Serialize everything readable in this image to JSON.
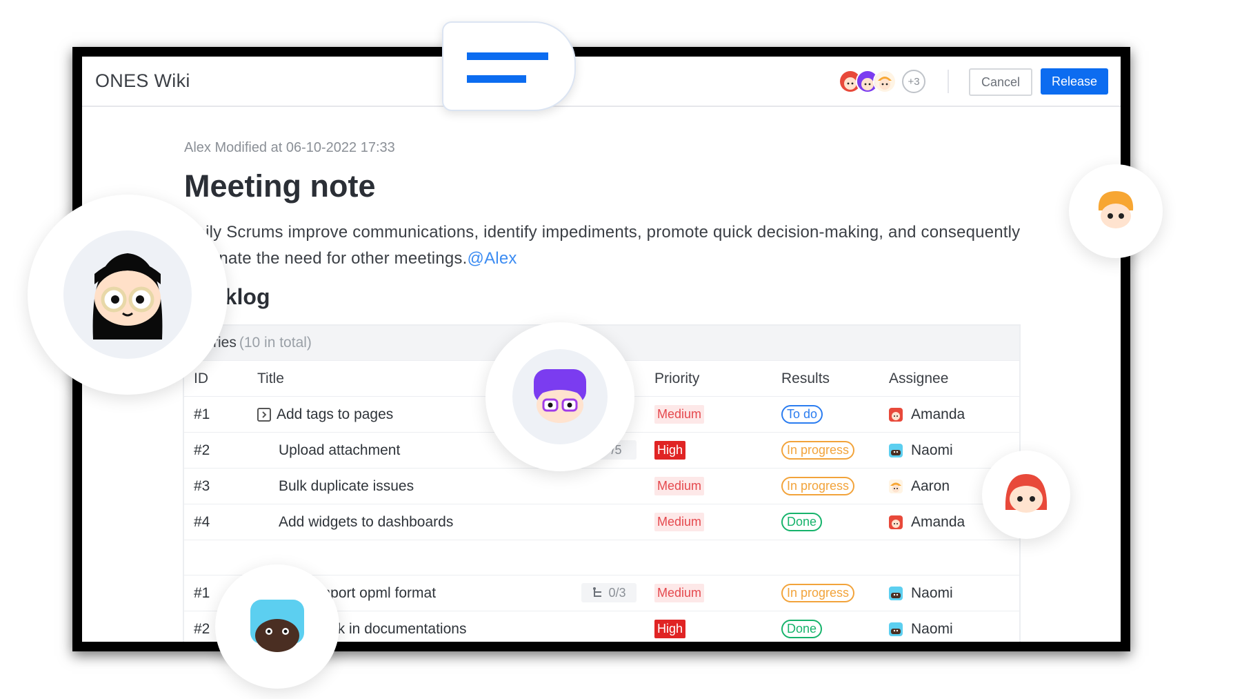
{
  "app": {
    "title": "ONES Wiki"
  },
  "topbar": {
    "more_collaborators": "+3",
    "cancel_label": "Cancel",
    "release_label": "Release"
  },
  "doc": {
    "meta": "Alex Modified at 06-10-2022 17:33",
    "title": "Meeting note",
    "paragraph": "Daily Scrums improve communications, identify impediments, promote quick decision-making, and consequently eliminate the need for other meetings.",
    "mention": "@Alex",
    "section_heading": "Backlog"
  },
  "table": {
    "group_label": "stories",
    "group_total": "(10 in total)",
    "headers": {
      "id": "ID",
      "title": "Title",
      "priority": "Priority",
      "results": "Results",
      "assignee": "Assignee"
    },
    "rows": [
      {
        "id": "#1",
        "title": "Add tags to pages",
        "priority": "Medium",
        "result": "To do",
        "assignee": "Amanda"
      },
      {
        "id": "#2",
        "title": "Upload attachment",
        "subtasks": "/5",
        "priority": "High",
        "result": "In progress",
        "assignee": "Naomi"
      },
      {
        "id": "#3",
        "title": "Bulk duplicate issues",
        "priority": "Medium",
        "result": "In progress",
        "assignee": "Aaron"
      },
      {
        "id": "#4",
        "title": "Add widgets to dashboards",
        "priority": "Medium",
        "result": "Done",
        "assignee": "Amanda"
      },
      {
        "id": "#1",
        "title": "import opml format",
        "subtasks": "0/3",
        "priority": "Medium",
        "result": "In progress",
        "assignee": "Naomi"
      },
      {
        "id": "#2",
        "title": "t link in documentations",
        "priority": "High",
        "result": "Done",
        "assignee": "Naomi"
      }
    ]
  },
  "colors": {
    "brand_blue": "#0c6cf0",
    "priority_medium_bg": "#fde8e8",
    "priority_high_bg": "#e02424",
    "result_todo": "#2a7cf0",
    "result_in_progress": "#f2a33a",
    "result_done": "#16b36b"
  }
}
